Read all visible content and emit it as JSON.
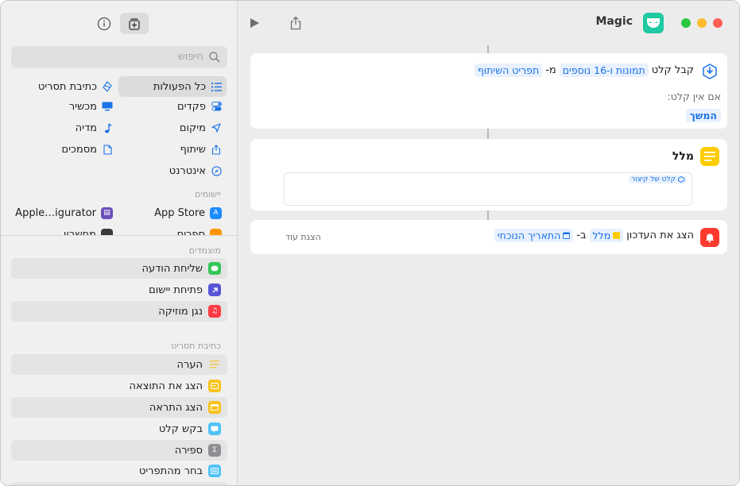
{
  "window": {
    "app_name": "Magic"
  },
  "toolbar": {
    "play_icon": "play-icon",
    "share_icon": "share-icon"
  },
  "sidebar": {
    "search_placeholder": "חיפוש",
    "categories_right": [
      {
        "label": "כל הפעולות",
        "icon": "list-icon",
        "selected": true
      },
      {
        "label": "פקדים",
        "icon": "toggle-icon"
      },
      {
        "label": "מיקום",
        "icon": "location-arrow-icon"
      },
      {
        "label": "שיתוף",
        "icon": "share-icon"
      },
      {
        "label": "אינטרנט",
        "icon": "compass-icon"
      }
    ],
    "categories_left": [
      {
        "label": "כתיבת תסריט",
        "icon": "scripting-icon"
      },
      {
        "label": "מכשיר",
        "icon": "monitor-icon"
      },
      {
        "label": "מדיה",
        "icon": "music-note-icon"
      },
      {
        "label": "מסמכים",
        "icon": "document-icon"
      }
    ],
    "apps_label": "יישומים",
    "apps": [
      {
        "label": "App Store",
        "icon": "app-store-icon"
      },
      {
        "label": "Apple…igurator",
        "icon": "configurator-icon"
      },
      {
        "label": "ספרים",
        "icon": "books-icon"
      },
      {
        "label": "מחשבון",
        "icon": "calculator-icon"
      }
    ],
    "suggested_label": "מוצמדים",
    "suggested": [
      {
        "label": "שליחת הודעה",
        "icon": "messages-icon",
        "color": "#34c759"
      },
      {
        "label": "פתיחת יישום",
        "icon": "open-app-icon",
        "color": "#5856d6"
      },
      {
        "label": "נגן מוזיקה",
        "icon": "music-icon",
        "color": "#fc3c44"
      }
    ],
    "scripting_label": "כתיבת תסריט",
    "scripting": [
      {
        "label": "הערה",
        "icon": "comment-lines-icon",
        "color": "#f7d54a"
      },
      {
        "label": "הצג את התוצאה",
        "icon": "show-result-icon",
        "color": "#f9c21a"
      },
      {
        "label": "הצג התראה",
        "icon": "alert-icon",
        "color": "#f9c21a"
      },
      {
        "label": "בקש קלט",
        "icon": "ask-input-icon",
        "color": "#4fc3f7"
      },
      {
        "label": "ספירה",
        "icon": "sigma-icon",
        "color": "#8e8e93"
      },
      {
        "label": "בחר מהתפריט",
        "icon": "menu-icon",
        "color": "#4fc3f7"
      }
    ]
  },
  "editor": {
    "receive": {
      "label": "קבל קלט",
      "token_types": "תמונות ו-16 נוספים",
      "from_label": "מ-",
      "token_source": "תפריט השיתוף",
      "no_input_label": "אם אין קלט:",
      "continue_label": "המשך",
      "icon": "receive-input-icon",
      "color": "#1a73e8"
    },
    "text": {
      "title": "מלל",
      "token": "קלט של קיצור",
      "icon": "text-lines-icon",
      "color": "#ffcc00"
    },
    "notification": {
      "label": "הצג את העדכון",
      "token_text": "מלל",
      "in_label": "ב-",
      "token_date": "התאריך הנוכחי",
      "show_more": "הצגת עוד",
      "icon": "bell-icon",
      "color": "#ff3b30"
    }
  }
}
